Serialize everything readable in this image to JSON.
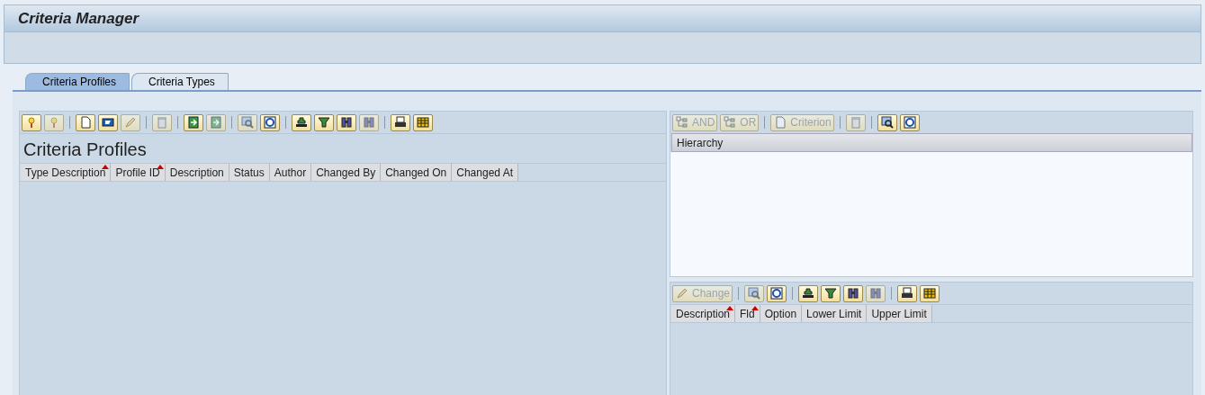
{
  "window": {
    "title": "Criteria Manager"
  },
  "tabs": [
    {
      "label": "Criteria Profiles",
      "selected": true
    },
    {
      "label": "Criteria Types",
      "selected": false
    }
  ],
  "profiles": {
    "toolbar": [
      [
        {
          "disabled": false
        },
        {
          "disabled": true
        }
      ],
      [
        {
          "disabled": false
        },
        {
          "disabled": false
        },
        {
          "disabled": true
        }
      ],
      [
        {
          "disabled": true
        }
      ],
      [
        {
          "disabled": false
        },
        {
          "disabled": true
        }
      ],
      [
        {
          "disabled": true
        },
        {
          "disabled": false
        }
      ],
      [
        {
          "disabled": false
        },
        {
          "disabled": false
        },
        {
          "disabled": false
        },
        {
          "disabled": true
        }
      ],
      [
        {
          "disabled": false
        },
        {
          "disabled": false
        }
      ]
    ],
    "title": "Criteria Profiles",
    "columns": [
      {
        "label": "Type Description",
        "sorted": true
      },
      {
        "label": "Profile ID",
        "sorted": true
      },
      {
        "label": "Description",
        "sorted": false
      },
      {
        "label": "Status",
        "sorted": false
      },
      {
        "label": "Author",
        "sorted": false
      },
      {
        "label": "Changed By",
        "sorted": false
      },
      {
        "label": "Changed On",
        "sorted": false
      },
      {
        "label": "Changed At",
        "sorted": false
      }
    ]
  },
  "hierarchy": {
    "toolbar": [
      [
        {
          "label": "AND",
          "disabled": true
        },
        {
          "label": "OR",
          "disabled": true
        }
      ],
      [
        {
          "label": "Criterion",
          "disabled": true
        }
      ],
      [
        {
          "disabled": true
        }
      ],
      [
        {
          "disabled": false
        },
        {
          "disabled": false
        }
      ]
    ],
    "header": "Hierarchy"
  },
  "criteria": {
    "toolbar": [
      [
        {
          "label": "Change",
          "disabled": true
        }
      ],
      [
        {
          "disabled": true
        },
        {
          "disabled": false
        }
      ],
      [
        {
          "disabled": false
        },
        {
          "disabled": false
        },
        {
          "disabled": false
        },
        {
          "disabled": true
        }
      ],
      [
        {
          "disabled": false
        },
        {
          "disabled": false
        }
      ]
    ],
    "columns": [
      {
        "label": "Description",
        "sorted": true
      },
      {
        "label": "Fld",
        "sorted": true
      },
      {
        "label": "Option",
        "sorted": false
      },
      {
        "label": "Lower Limit",
        "sorted": false
      },
      {
        "label": "Upper Limit",
        "sorted": false
      }
    ]
  }
}
